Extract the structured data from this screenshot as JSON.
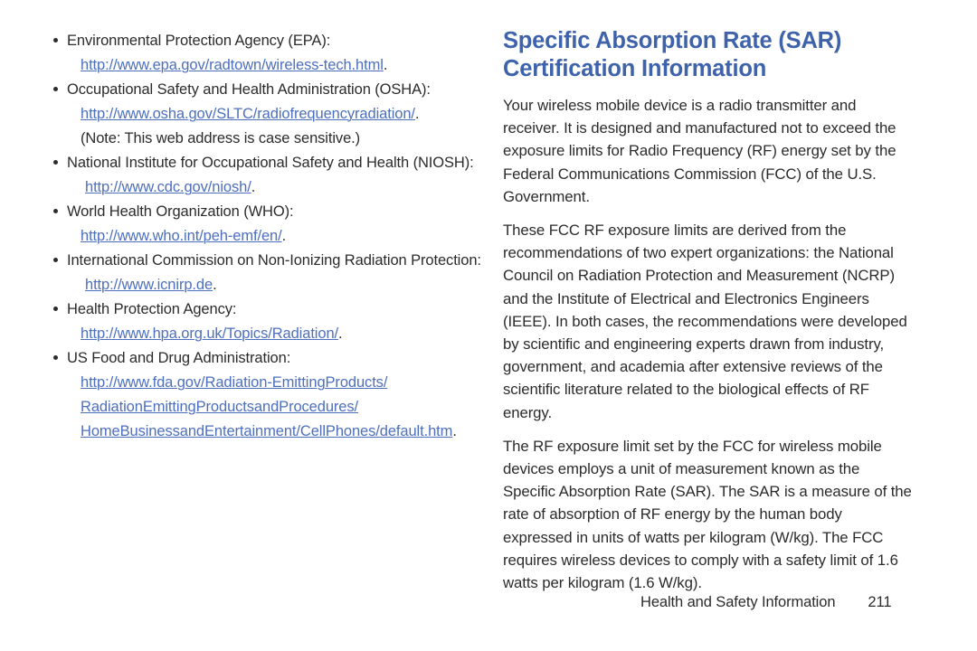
{
  "left_column": {
    "bullets": [
      {
        "title": "Environmental Protection Agency (EPA):",
        "lines": [
          {
            "type": "link",
            "text": "http://www.epa.gov/radtown/wireless-tech.html",
            "trailing": ".",
            "indent": "normal"
          }
        ]
      },
      {
        "title": "Occupational Safety and Health Administration (OSHA):",
        "lines": [
          {
            "type": "link",
            "text": "http://www.osha.gov/SLTC/radiofrequencyradiation/",
            "trailing": ".",
            "indent": "normal"
          },
          {
            "type": "text",
            "text": "(Note: This web address is case sensitive.)",
            "trailing": "",
            "indent": "normal"
          }
        ]
      },
      {
        "title": "National Institute for Occupational Safety and Health (NIOSH):",
        "lines": [
          {
            "type": "link",
            "text": "http://www.cdc.gov/niosh/",
            "trailing": ".",
            "indent": "extra"
          }
        ]
      },
      {
        "title": "World Health Organization (WHO):",
        "lines": [
          {
            "type": "link",
            "text": "http://www.who.int/peh-emf/en/",
            "trailing": ".",
            "indent": "normal"
          }
        ]
      },
      {
        "title": "International Commission on Non-Ionizing Radiation Protection:",
        "lines": [
          {
            "type": "link",
            "text": "http://www.icnirp.de",
            "trailing": ".",
            "indent": "extra"
          }
        ]
      },
      {
        "title": "Health Protection Agency:",
        "lines": [
          {
            "type": "link",
            "text": "http://www.hpa.org.uk/Topics/Radiation/",
            "trailing": ".",
            "indent": "normal"
          }
        ]
      },
      {
        "title": "US Food and Drug Administration:",
        "lines": [
          {
            "type": "link",
            "text": "http://www.fda.gov/Radiation-EmittingProducts/",
            "trailing": "",
            "indent": "normal"
          },
          {
            "type": "link",
            "text": "RadiationEmittingProductsandProcedures/",
            "trailing": "",
            "indent": "normal"
          },
          {
            "type": "link",
            "text": "HomeBusinessandEntertainment/CellPhones/default.htm",
            "trailing": ".",
            "indent": "normal"
          }
        ]
      }
    ]
  },
  "right_column": {
    "heading": "Specific Absorption Rate (SAR) Certification Information",
    "paragraphs": [
      "Your wireless mobile device is a radio transmitter and receiver. It is designed and manufactured not to exceed the exposure limits for Radio Frequency (RF) energy set by the Federal Communications Commission (FCC) of the U.S. Government.",
      "These FCC RF exposure limits are derived from the recommendations of two expert organizations: the National Council on Radiation Protection and Measurement (NCRP) and the Institute of Electrical and Electronics Engineers (IEEE). In both cases, the recommendations were developed by scientific and engineering experts drawn from industry, government, and academia after extensive reviews of the scientific literature related to the biological effects of RF energy.",
      "The RF exposure limit set by the FCC for wireless mobile devices employs a unit of measurement known as the Specific Absorption Rate (SAR). The SAR is a measure of the rate of absorption of RF energy by the human body expressed in units of watts per kilogram (W/kg). The FCC requires wireless devices to comply with a safety limit of 1.6 watts per kilogram (1.6 W/kg)."
    ]
  },
  "footer": {
    "label": "Health and Safety Information",
    "page_number": "211"
  },
  "colors": {
    "heading_blue": "#3e63ab",
    "link_blue": "#4d6fbe",
    "body_text": "#2b2b2b",
    "background": "#ffffff"
  }
}
